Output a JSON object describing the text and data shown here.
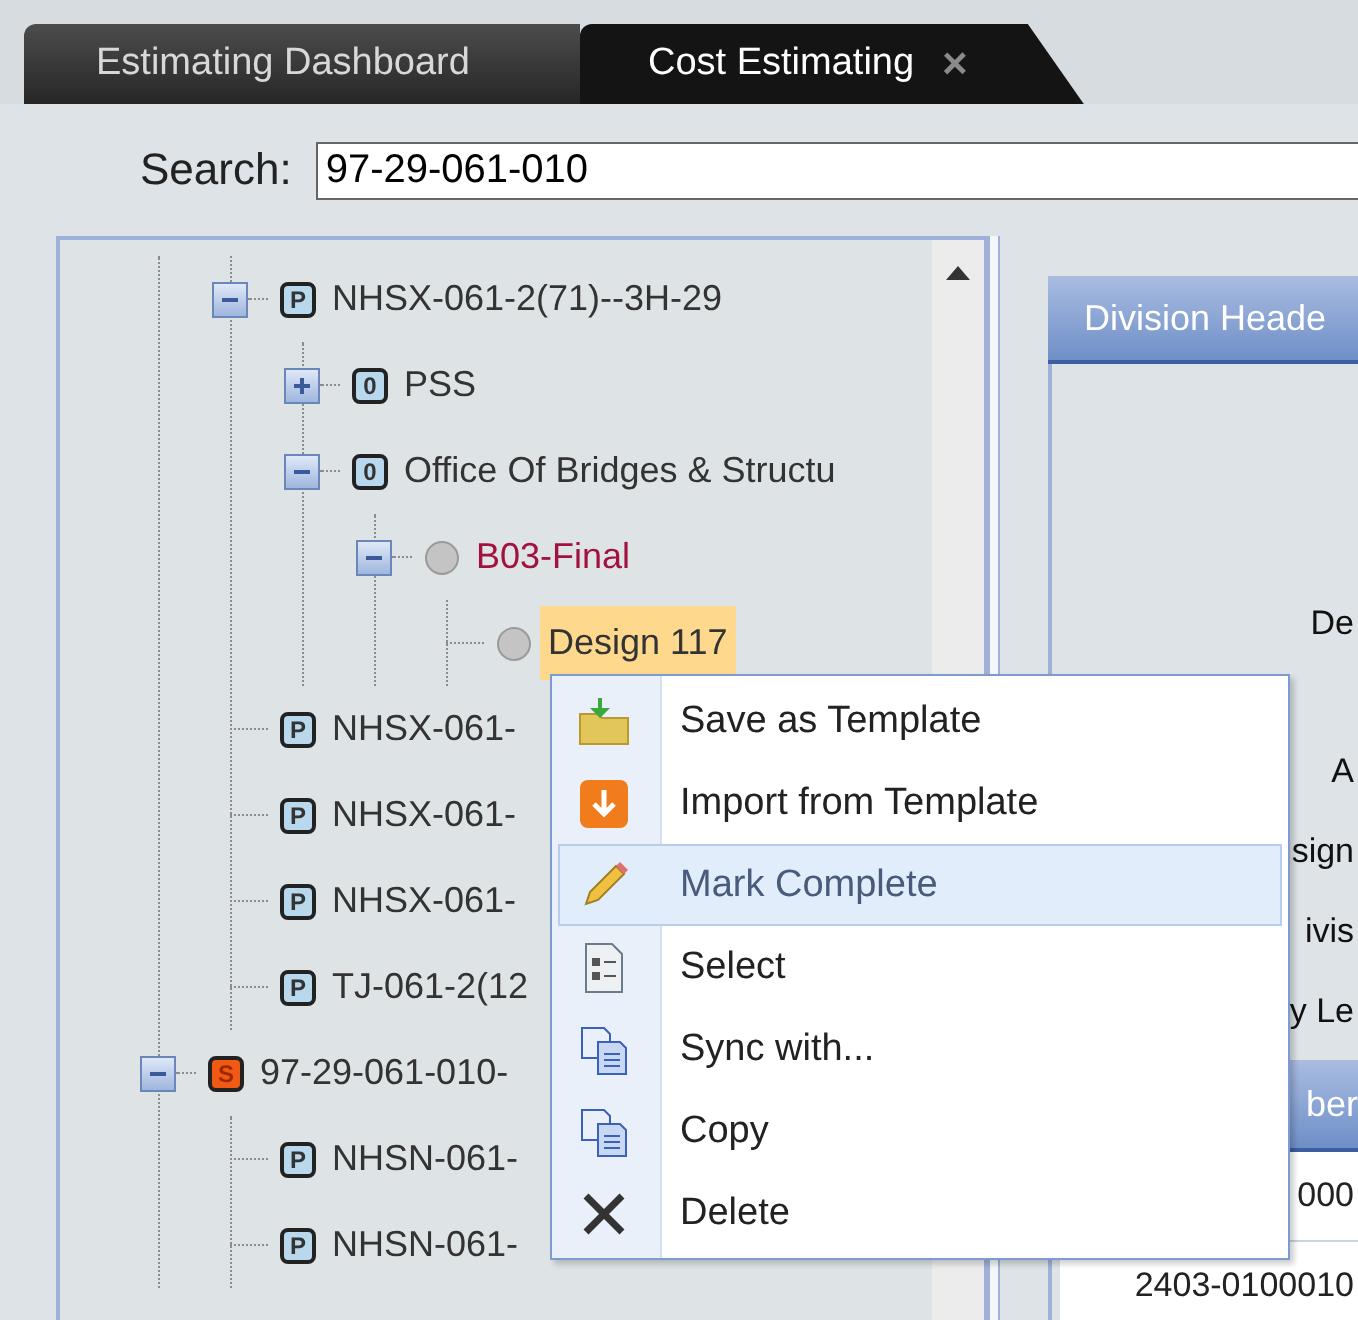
{
  "tabs": [
    {
      "label": "Estimating Dashboard",
      "selected": false
    },
    {
      "label": "Cost Estimating",
      "selected": true,
      "close_glyph": "×"
    }
  ],
  "search": {
    "label": "Search:",
    "value": "97-29-061-010"
  },
  "tree": {
    "continued_children": [
      {
        "label": "NHSX-061-2(71)--3H-29",
        "kind": "badge",
        "badge": "P",
        "color": "#333333",
        "expanded": true,
        "selected": false,
        "children": [
          {
            "label": "PSS",
            "kind": "badge",
            "badge": "0",
            "color": "#333333",
            "expanded": false,
            "selected": false
          },
          {
            "label": "Office Of Bridges & Structu",
            "kind": "badge",
            "badge": "0",
            "color": "#333333",
            "expanded": true,
            "selected": false,
            "children": [
              {
                "label": "B03-Final",
                "kind": "ball",
                "color": "#a3123f",
                "expanded": true,
                "selected": false,
                "children": [
                  {
                    "label": "Design 117",
                    "kind": "ball",
                    "color": "#333333",
                    "selected": true
                  }
                ]
              }
            ]
          }
        ]
      },
      {
        "label": "NHSX-061-",
        "kind": "badge",
        "badge": "P",
        "color": "#333333",
        "selected": false
      },
      {
        "label": "NHSX-061-",
        "kind": "badge",
        "badge": "P",
        "color": "#333333",
        "selected": false
      },
      {
        "label": "NHSX-061-",
        "kind": "badge",
        "badge": "P",
        "color": "#333333",
        "selected": false
      },
      {
        "label": "TJ-061-2(12",
        "kind": "badge",
        "badge": "P",
        "color": "#333333",
        "selected": false
      }
    ],
    "nodes": [
      {
        "label": "97-29-061-010-",
        "kind": "orange-badge",
        "badge": "S",
        "color": "#333333",
        "expanded": true,
        "selected": false,
        "children": [
          {
            "label": "NHSN-061-",
            "kind": "badge",
            "badge": "P",
            "color": "#333333",
            "selected": false
          },
          {
            "label": "NHSN-061-",
            "kind": "badge",
            "badge": "P",
            "color": "#333333",
            "selected": false
          }
        ]
      }
    ]
  },
  "context_menu": {
    "items": [
      {
        "label": "Save as Template",
        "kind": "folder",
        "selected": false
      },
      {
        "label": "Import from Template",
        "kind": "import",
        "selected": false
      },
      {
        "label": "Mark Complete",
        "kind": "pencil",
        "selected": true
      },
      {
        "label": "Select",
        "kind": "form",
        "selected": false
      },
      {
        "label": "Sync with...",
        "kind": "copy",
        "selected": false
      },
      {
        "label": "Copy",
        "kind": "copy",
        "selected": false
      },
      {
        "label": "Delete",
        "kind": "delete",
        "selected": false
      }
    ]
  },
  "details": {
    "header": "Division Heade",
    "labels": [
      "De",
      "A",
      "sign",
      "ivis",
      "y Le"
    ],
    "table": {
      "header": "ber",
      "rows": [
        "000",
        "2403-0100010"
      ]
    }
  }
}
